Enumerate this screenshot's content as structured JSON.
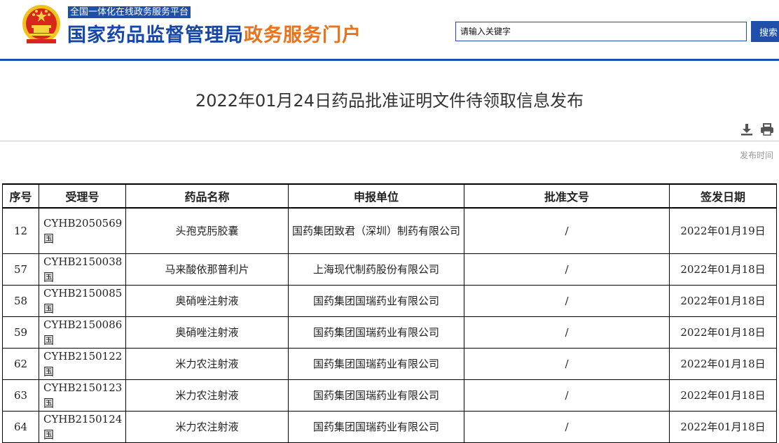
{
  "header": {
    "platform_tag": "全国一体化在线政务服务平台",
    "title_main": "国家药品监督管理局",
    "title_sub": "政务服务门户",
    "emblem": "national-emblem-icon",
    "colors": {
      "brand_blue": "#1f4fa8",
      "accent_orange": "#e8731c"
    }
  },
  "search": {
    "placeholder": "请输入关键字",
    "button_label": "搜索"
  },
  "article": {
    "title": "2022年01月24日药品批准证明文件待领取信息发布",
    "publish_label": "发布时间",
    "tools": [
      "download-icon",
      "print-icon"
    ]
  },
  "table": {
    "columns": [
      "序号",
      "受理号",
      "药品名称",
      "申报单位",
      "批准文号",
      "签发日期"
    ],
    "rows": [
      {
        "no": "12",
        "accept": "CYHB2050569国",
        "drug": "头孢克肟胶囊",
        "applicant": "国药集团致君（深圳）制药有限公司",
        "approval": "/",
        "date": "2022年01月19日"
      },
      {
        "no": "57",
        "accept": "CYHB2150038国",
        "drug": "马来酸依那普利片",
        "applicant": "上海现代制药股份有限公司",
        "approval": "/",
        "date": "2022年01月18日"
      },
      {
        "no": "58",
        "accept": "CYHB2150085国",
        "drug": "奥硝唑注射液",
        "applicant": "国药集团国瑞药业有限公司",
        "approval": "/",
        "date": "2022年01月18日"
      },
      {
        "no": "59",
        "accept": "CYHB2150086国",
        "drug": "奥硝唑注射液",
        "applicant": "国药集团国瑞药业有限公司",
        "approval": "/",
        "date": "2022年01月18日"
      },
      {
        "no": "62",
        "accept": "CYHB2150122国",
        "drug": "米力农注射液",
        "applicant": "国药集团国瑞药业有限公司",
        "approval": "/",
        "date": "2022年01月18日"
      },
      {
        "no": "63",
        "accept": "CYHB2150123国",
        "drug": "米力农注射液",
        "applicant": "国药集团国瑞药业有限公司",
        "approval": "/",
        "date": "2022年01月18日"
      },
      {
        "no": "64",
        "accept": "CYHB2150124国",
        "drug": "米力农注射液",
        "applicant": "国药集团国瑞药业有限公司",
        "approval": "/",
        "date": "2022年01月18日"
      }
    ]
  }
}
